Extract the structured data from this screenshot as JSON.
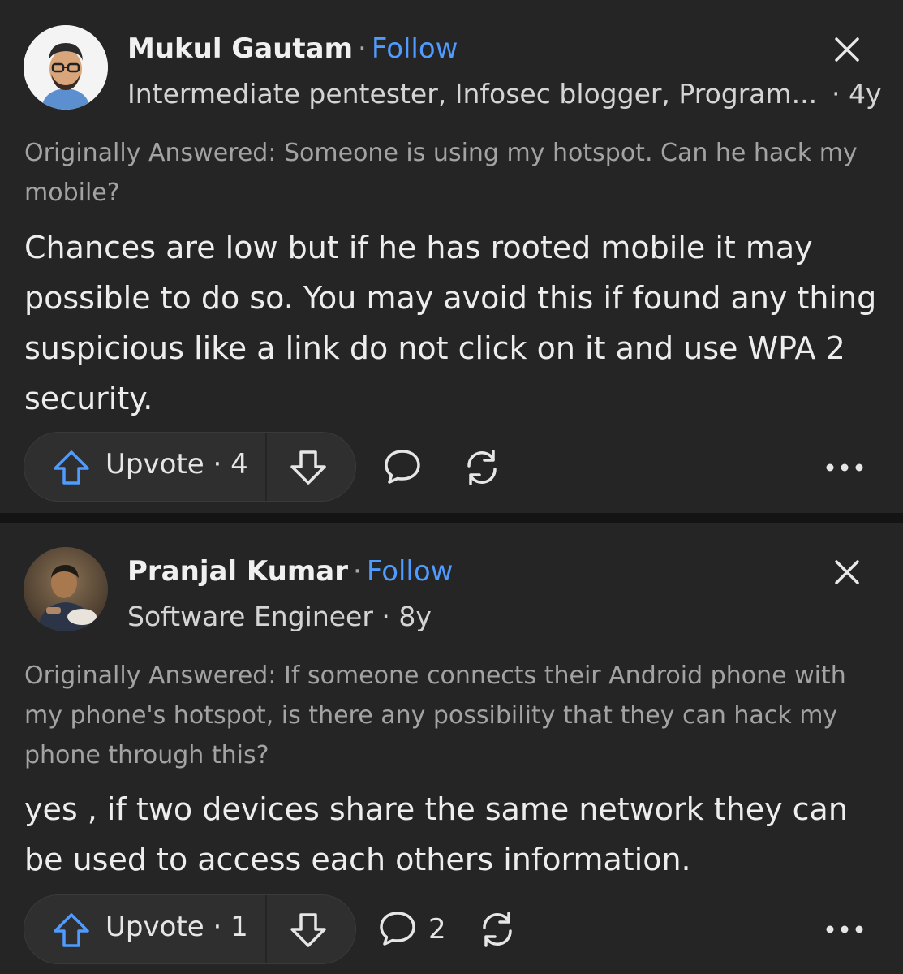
{
  "answers": [
    {
      "author": "Mukul Gautam",
      "follow_label": "Follow",
      "credential": "Intermediate pentester, Infosec blogger, Program...",
      "age": "· 4y",
      "originally_answered": "Originally Answered: Someone is using my hotspot. Can he hack my mobile?",
      "body": "Chances are low but if he has rooted mobile it may possible to do so. You may avoid this if found any thing suspicious like a link do not click on it and use WPA 2 security.",
      "upvote_label": "Upvote · 4",
      "comment_count": ""
    },
    {
      "author": "Pranjal Kumar",
      "follow_label": "Follow",
      "credential": "Software Engineer · 8y",
      "age": "",
      "originally_answered": "Originally Answered: If someone connects their Android phone with my phone's hotspot, is there any possibility that they can hack my phone through this?",
      "body": "yes , if two devices share the same network they can be used to access each others information.",
      "upvote_label": "Upvote · 1",
      "comment_count": "2"
    }
  ],
  "name_separator": "·",
  "colors": {
    "background": "#252525",
    "link": "#4f9bff",
    "upvote_icon": "#4f9bff",
    "divider": "#141414"
  },
  "icons": [
    "close-icon",
    "upvote-arrow-icon",
    "downvote-arrow-icon",
    "comment-icon",
    "share-icon",
    "more-icon"
  ]
}
